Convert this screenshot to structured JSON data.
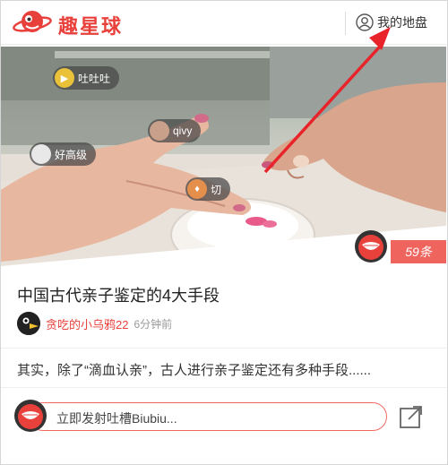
{
  "header": {
    "brand": "趣星球",
    "my_site_label": "我的地盘"
  },
  "hero": {
    "danmu": [
      {
        "text": "吐吐吐",
        "avatar_color": "#e9c23a"
      },
      {
        "text": "qivy",
        "avatar_color": "#c9a08a"
      },
      {
        "text": "好高级",
        "avatar_color": "#e8e8e8"
      },
      {
        "text": "切",
        "avatar_color": "#e58f4d"
      }
    ],
    "comment_count": "59条"
  },
  "article": {
    "title": "中国古代亲子鉴定的4大手段",
    "author": "贪吃的小乌鸦22",
    "time": "6分钟前",
    "excerpt": "其实，除了“滴血认亲”，古人进行亲子鉴定还有多种手段......"
  },
  "comment": {
    "placeholder": "立即发射吐槽Biubiu..."
  },
  "colors": {
    "accent": "#e8413c",
    "badge": "#f0645e"
  }
}
